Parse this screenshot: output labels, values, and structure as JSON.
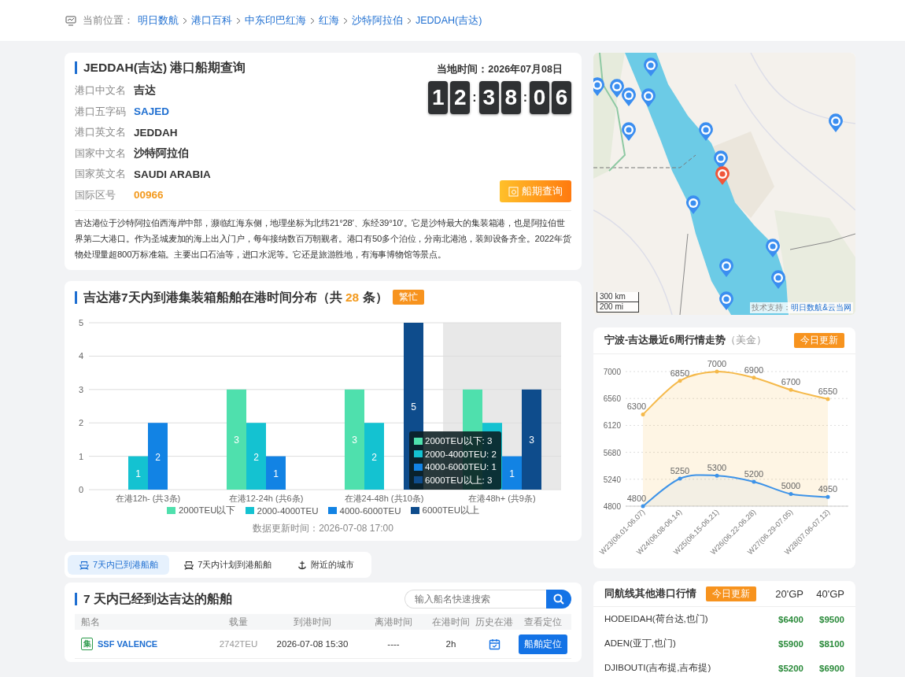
{
  "breadcrumb": {
    "label": "当前位置：",
    "items": [
      "明日数航",
      "港口百科",
      "中东印巴红海",
      "红海",
      "沙特阿拉伯",
      "JEDDAH(吉达)"
    ]
  },
  "port": {
    "title": "JEDDAH(吉达) 港口船期查询",
    "fields": [
      {
        "label": "港口中文名",
        "value": "吉达",
        "kind": "text"
      },
      {
        "label": "港口五字码",
        "value": "SAJED",
        "kind": "link"
      },
      {
        "label": "港口英文名",
        "value": "JEDDAH",
        "kind": "text"
      },
      {
        "label": "国家中文名",
        "value": "沙特阿拉伯",
        "kind": "text"
      },
      {
        "label": "国家英文名",
        "value": "SAUDI ARABIA",
        "kind": "text"
      },
      {
        "label": "国际区号",
        "value": "00966",
        "kind": "highlight"
      }
    ],
    "local_time": "当地时间：2026年07月08日",
    "clock": [
      {
        "kind": "digit",
        "text": "1"
      },
      {
        "kind": "digit",
        "text": "2"
      },
      {
        "kind": "separator",
        "text": ":"
      },
      {
        "kind": "digit",
        "text": "3"
      },
      {
        "kind": "digit",
        "text": "8"
      },
      {
        "kind": "separator",
        "text": ":"
      },
      {
        "kind": "digit",
        "text": "0"
      },
      {
        "kind": "digit",
        "text": "6"
      }
    ],
    "query_button": "船期查询",
    "description": "吉达港位于沙特阿拉伯西海岸中部，濒临红海东侧，地理坐标为北纬21°28′、东经39°10′。它是沙特最大的集装箱港，也是阿拉伯世界第二大港口。作为圣城麦加的海上出入门户，每年接纳数百万朝觐者。港口有50多个泊位，分南北港池，装卸设备齐全。2022年货物处理量超800万标准箱。主要出口石油等，进口水泥等。它还是旅游胜地，有海事博物馆等景点。"
  },
  "distribution": {
    "title_prefix": "吉达港7天内到港集装箱船舶在港时间分布（共",
    "count": "28",
    "title_suffix": "条）",
    "badge": "繁忙",
    "highlighted": [
      false,
      false,
      false,
      true
    ],
    "chart_data": {
      "type": "bar",
      "categories": [
        "在港12h- (共3条)",
        "在港12-24h (共6条)",
        "在港24-48h (共10条)",
        "在港48h+ (共9条)"
      ],
      "series": [
        {
          "name": "2000TEU以下",
          "color": "#4fe0ad",
          "values": [
            null,
            3,
            3,
            3
          ]
        },
        {
          "name": "2000-4000TEU",
          "color": "#14c2d1",
          "values": [
            1,
            2,
            2,
            2
          ]
        },
        {
          "name": "4000-6000TEU",
          "color": "#1283e4",
          "values": [
            2,
            1,
            null,
            1
          ]
        },
        {
          "name": "6000TEU以上",
          "color": "#0e4c8c",
          "values": [
            null,
            null,
            5,
            3
          ]
        }
      ],
      "ylim": [
        0,
        5
      ],
      "yticks": [
        0,
        1,
        2,
        3,
        4,
        5
      ],
      "grid": true,
      "value_labels": [
        [
          null,
          "3",
          "3",
          null
        ],
        [
          "1",
          "2",
          "2",
          null
        ],
        [
          "2",
          "1",
          null,
          "1"
        ],
        [
          null,
          null,
          "5",
          "3"
        ]
      ]
    },
    "tooltip": [
      "2000TEU以下: 3",
      "2000-4000TEU: 2",
      "4000-6000TEU: 1",
      "6000TEU以上: 3"
    ],
    "updated": "数据更新时间：2026-07-08 17:00"
  },
  "tabs": [
    {
      "label": "7天内已到港船舶",
      "selected": true
    },
    {
      "label": "7天内计划到港船舶",
      "selected": false
    },
    {
      "label": "附近的城市",
      "selected": false
    }
  ],
  "vessels": {
    "title": "7 天内已经到达吉达的船舶",
    "search": {
      "placeholder": "输入船名快速搜索"
    },
    "columns": [
      "船名",
      "载量",
      "到港时间",
      "离港时间",
      "在港时间",
      "历史在港",
      "查看定位"
    ],
    "rows": [
      {
        "badge": "集",
        "name": "SSF VALENCE",
        "capacity": "2742TEU",
        "arrival": "2026-07-08 15:30",
        "departure": "----",
        "duration": "2h",
        "locate": "船舶定位"
      }
    ]
  },
  "map": {
    "kind": "picture",
    "scale": [
      "300 km",
      "200 mi"
    ],
    "attribution_label": "技术支持：",
    "attribution_link": "明日数航&云当网"
  },
  "trend": {
    "title": "宁波-吉达最近6周行情走势",
    "unit": "（美金）",
    "badge": "今日更新",
    "chart_data": {
      "type": "area",
      "categories": [
        "W23(06.01-06.07)",
        "W24(06.08-06.14)",
        "W25(06.15-06.21)",
        "W26(06.22-06.28)",
        "W27(06.29-07.05)",
        "W28(07.06-07.12)"
      ],
      "series": [
        {
          "color": "#f5b94a",
          "values": [
            6300,
            6850,
            7000,
            6900,
            6700,
            6550
          ]
        },
        {
          "color": "#3d93e8",
          "values": [
            4800,
            5250,
            5300,
            5200,
            5000,
            4950
          ]
        }
      ],
      "ylim": [
        4800,
        7000
      ],
      "yticks": [
        4800,
        5240,
        5680,
        6120,
        6560,
        7000
      ],
      "grid": true,
      "data_labels": true
    }
  },
  "other_ports": {
    "title": "同航线其他港口行情",
    "badge": "今日更新",
    "columns": [
      "20'GP",
      "40'GP"
    ],
    "rows": [
      {
        "port": "HODEIDAH(荷台达,也门)",
        "gp20": "$6400",
        "gp40": "$9500"
      },
      {
        "port": "ADEN(亚丁,也门)",
        "gp20": "$5900",
        "gp40": "$8100"
      },
      {
        "port": "DJIBOUTI(吉布提,吉布提)",
        "gp20": "$5200",
        "gp40": "$6900"
      }
    ]
  }
}
